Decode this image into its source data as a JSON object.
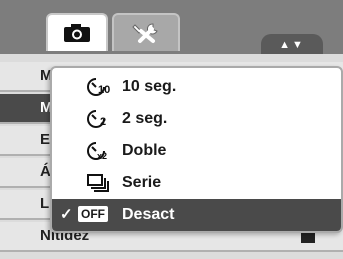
{
  "tabs": [
    {
      "name": "camera-icon",
      "active": true
    },
    {
      "name": "setup-tools-icon",
      "active": false
    }
  ],
  "scroll_indicator": "▲▼",
  "menu": {
    "rows": [
      {
        "label": "M",
        "selected": false
      },
      {
        "label": "M",
        "selected": true
      },
      {
        "label": "E",
        "selected": false
      },
      {
        "label": "Á",
        "selected": false
      },
      {
        "label": "L",
        "selected": false
      },
      {
        "label": "Nitidez",
        "selected": false
      }
    ]
  },
  "popup": {
    "items": [
      {
        "icon": "self-timer-10s-icon",
        "label": "10 seg.",
        "selected": false
      },
      {
        "icon": "self-timer-2s-icon",
        "label": "2 seg.",
        "selected": false
      },
      {
        "icon": "self-timer-double-icon",
        "label": "Doble",
        "selected": false
      },
      {
        "icon": "burst-series-icon",
        "label": "Serie",
        "selected": false
      },
      {
        "icon": "off-icon",
        "label": "Desact",
        "selected": true,
        "badge": "OFF",
        "check": "✓"
      }
    ]
  },
  "colors": {
    "background": "#7d7d7d",
    "selected": "#4a4a4a",
    "row": "#e6e6e6"
  }
}
